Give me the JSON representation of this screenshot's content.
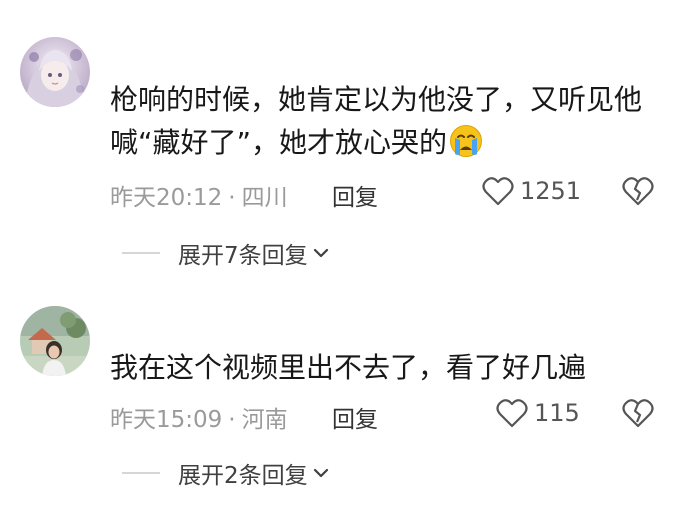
{
  "comments": [
    {
      "username": "",
      "text_line1": "枪响的时候，她肯定以为他没了，又听见他",
      "text_line2": "喊“藏好了”，她才放心哭的",
      "time": "昨天20:12",
      "separator": "·",
      "location": "四川",
      "reply_label": "回复",
      "likes": "1251",
      "expand_label": "展开7条回复",
      "emoji": "crying-face-icon"
    },
    {
      "username": "",
      "text_line1": "我在这个视频里出不去了，看了好几遍",
      "time": "昨天15:09",
      "separator": "·",
      "location": "河南",
      "reply_label": "回复",
      "likes": "115",
      "expand_label": "展开2条回复"
    }
  ],
  "colors": {
    "meta_text": "#9a9a9a",
    "body_text": "#181818",
    "emoji_face": "#f7c21a",
    "emoji_tears": "#4aa3f0"
  }
}
